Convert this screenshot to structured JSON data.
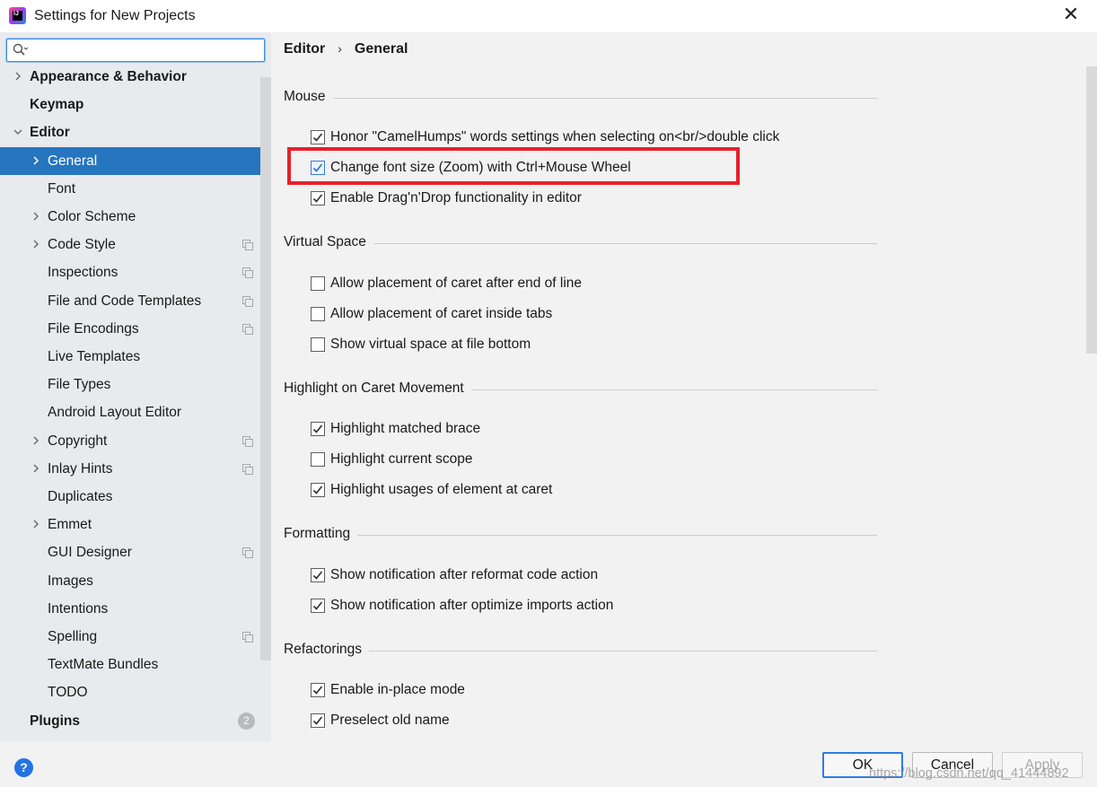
{
  "window": {
    "title": "Settings for New Projects",
    "app_icon_text": "IJ"
  },
  "sidebar": {
    "search": {
      "placeholder": "",
      "value": ""
    },
    "items": [
      {
        "label": "Appearance & Behavior",
        "bold": true,
        "expandable": true,
        "expanded": false
      },
      {
        "label": "Keymap",
        "bold": true,
        "expandable": false
      },
      {
        "label": "Editor",
        "bold": true,
        "expandable": true,
        "expanded": true
      },
      {
        "label": "General",
        "expandable": true,
        "expanded": false,
        "selected": true
      },
      {
        "label": "Font"
      },
      {
        "label": "Color Scheme",
        "expandable": true
      },
      {
        "label": "Code Style",
        "expandable": true,
        "project_icon": true
      },
      {
        "label": "Inspections",
        "project_icon": true
      },
      {
        "label": "File and Code Templates",
        "project_icon": true
      },
      {
        "label": "File Encodings",
        "project_icon": true
      },
      {
        "label": "Live Templates"
      },
      {
        "label": "File Types"
      },
      {
        "label": "Android Layout Editor"
      },
      {
        "label": "Copyright",
        "expandable": true,
        "project_icon": true
      },
      {
        "label": "Inlay Hints",
        "expandable": true,
        "project_icon": true
      },
      {
        "label": "Duplicates"
      },
      {
        "label": "Emmet",
        "expandable": true
      },
      {
        "label": "GUI Designer",
        "project_icon": true
      },
      {
        "label": "Images"
      },
      {
        "label": "Intentions"
      },
      {
        "label": "Spelling",
        "project_icon": true
      },
      {
        "label": "TextMate Bundles"
      },
      {
        "label": "TODO"
      },
      {
        "label": "Plugins",
        "bold": true,
        "badge": "2"
      }
    ]
  },
  "breadcrumb": {
    "parent": "Editor",
    "separator": "›",
    "current": "General"
  },
  "sections": [
    {
      "title": "Mouse",
      "options": [
        {
          "label": "Honor \"CamelHumps\" words settings when selecting on<br/>double click",
          "checked": true
        },
        {
          "label": "Change font size (Zoom) with Ctrl+Mouse Wheel",
          "checked": true,
          "highlighted": true
        },
        {
          "label": "Enable Drag'n'Drop functionality in editor",
          "checked": true
        }
      ]
    },
    {
      "title": "Virtual Space",
      "options": [
        {
          "label": "Allow placement of caret after end of line",
          "checked": false
        },
        {
          "label": "Allow placement of caret inside tabs",
          "checked": false
        },
        {
          "label": "Show virtual space at file bottom",
          "checked": false
        }
      ]
    },
    {
      "title": "Highlight on Caret Movement",
      "options": [
        {
          "label": "Highlight matched brace",
          "checked": true
        },
        {
          "label": "Highlight current scope",
          "checked": false
        },
        {
          "label": "Highlight usages of element at caret",
          "checked": true
        }
      ]
    },
    {
      "title": "Formatting",
      "options": [
        {
          "label": "Show notification after reformat code action",
          "checked": true
        },
        {
          "label": "Show notification after optimize imports action",
          "checked": true
        }
      ]
    },
    {
      "title": "Refactorings",
      "options": [
        {
          "label": "Enable in-place mode",
          "checked": true
        },
        {
          "label": "Preselect old name",
          "checked": true
        }
      ]
    }
  ],
  "footer": {
    "help_label": "?",
    "ok_label": "OK",
    "cancel_label": "Cancel",
    "apply_label": "Apply",
    "watermark": "https://blog.csdn.net/qq_41444892"
  },
  "colors": {
    "selection": "#2675bf",
    "highlight_box": "#e62129",
    "accent": "#2f7ce0"
  }
}
